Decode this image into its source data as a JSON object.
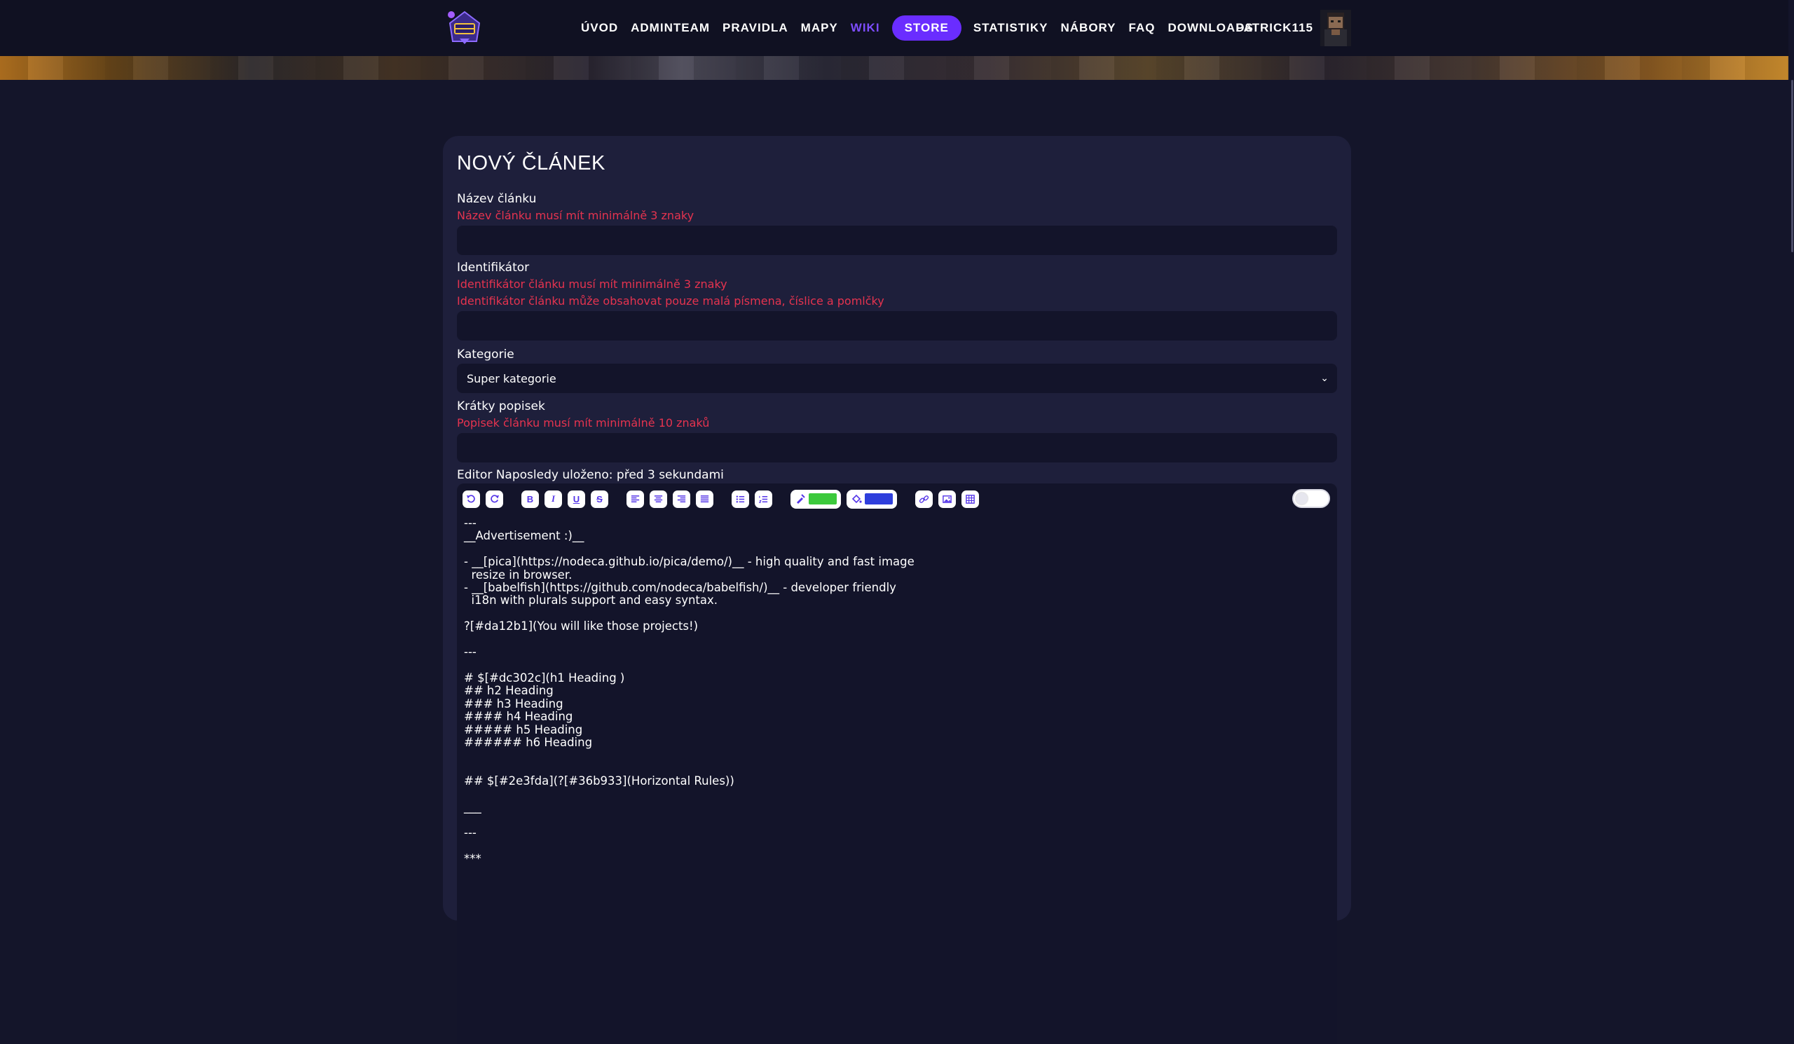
{
  "nav": {
    "items": [
      {
        "label": "ÚVOD"
      },
      {
        "label": "ADMINTEAM"
      },
      {
        "label": "PRAVIDLA"
      },
      {
        "label": "MAPY"
      },
      {
        "label": "WIKI"
      },
      {
        "label": "STORE"
      },
      {
        "label": "STATISTIKY"
      },
      {
        "label": "NÁBORY"
      },
      {
        "label": "FAQ"
      },
      {
        "label": "DOWNLOADS"
      }
    ],
    "active": "WIKI",
    "user": "PATRICK115",
    "accent": "#6a2dff"
  },
  "form": {
    "title": "NOVÝ ČLÁNEK",
    "name_label": "Název článku",
    "name_error": "Název článku musí mít minimálně 3 znaky",
    "name_value": "",
    "id_label": "Identifikátor",
    "id_error_1": "Identifikátor článku musí mít minimálně 3 znaky",
    "id_error_2": "Identifikátor článku může obsahovat pouze malá písmena, číslice a pomlčky",
    "id_value": "",
    "category_label": "Kategorie",
    "category_value": "Super kategorie",
    "desc_label": "Krátky popisek",
    "desc_error": "Popisek článku musí mít minimálně 10 znaků",
    "desc_value": "",
    "editor_label": "Editor Naposledy uloženo: před 3 sekundami"
  },
  "editor": {
    "text_color": "#3cc93c",
    "bg_color": "#2f3fdc",
    "icons": [
      "undo-icon",
      "redo-icon",
      "bold-icon",
      "italic-icon",
      "underline-icon",
      "strikethrough-icon",
      "align-left-icon",
      "align-center-icon",
      "align-right-icon",
      "align-justify-icon",
      "bullet-list-icon",
      "numbered-list-icon",
      "text-color-icon",
      "background-color-icon",
      "link-icon",
      "image-icon",
      "table-icon"
    ],
    "content": "---\n__Advertisement :)__\n\n- __[pica](https://nodeca.github.io/pica/demo/)__ - high quality and fast image\n  resize in browser.\n- __[babelfish](https://github.com/nodeca/babelfish/)__ - developer friendly\n  i18n with plurals support and easy syntax.\n\n?[#da12b1](You will like those projects!)\n\n---\n\n# $[#dc302c](h1 Heading )\n## h2 Heading\n### h3 Heading\n#### h4 Heading\n##### h5 Heading\n###### h6 Heading\n\n\n## $[#2e3fda](?[#36b933](Horizontal Rules))\n\n___\n\n---\n\n***"
  }
}
